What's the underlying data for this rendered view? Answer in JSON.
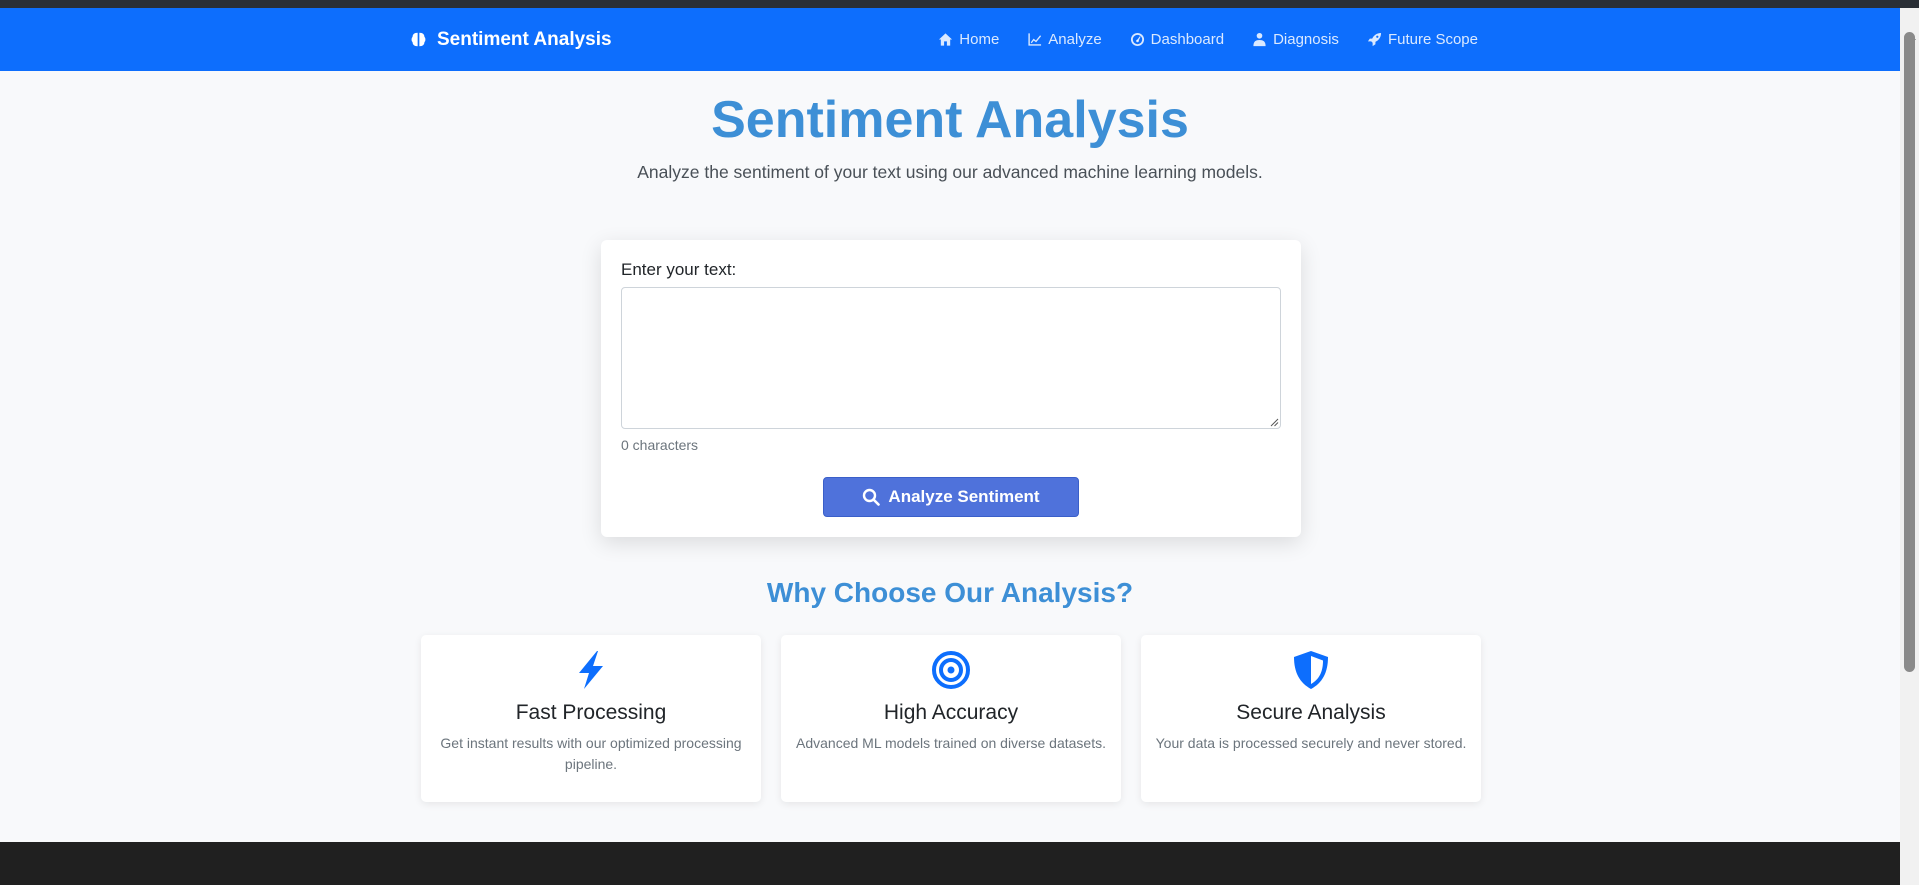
{
  "navbar": {
    "brand": "Sentiment Analysis",
    "brand_icon": "brain-icon",
    "links": [
      {
        "label": "Home",
        "icon": "home-icon"
      },
      {
        "label": "Analyze",
        "icon": "chart-line-icon"
      },
      {
        "label": "Dashboard",
        "icon": "gauge-icon"
      },
      {
        "label": "Diagnosis",
        "icon": "user-md-icon"
      },
      {
        "label": "Future Scope",
        "icon": "rocket-icon"
      }
    ]
  },
  "hero": {
    "title": "Sentiment Analysis",
    "subtitle": "Analyze the sentiment of your text using our advanced machine learning models."
  },
  "analyzer": {
    "label": "Enter your text:",
    "text_value": "",
    "placeholder": "",
    "char_count": "0",
    "char_suffix": " characters",
    "button_label": "Analyze Sentiment",
    "button_icon": "search-icon"
  },
  "why": {
    "title": "Why Choose Our Analysis?",
    "features": [
      {
        "title": "Fast Processing",
        "description": "Get instant results with our optimized processing pipeline.",
        "icon": "bolt-icon"
      },
      {
        "title": "High Accuracy",
        "description": "Advanced ML models trained on diverse datasets.",
        "icon": "target-icon"
      },
      {
        "title": "Secure Analysis",
        "description": "Your data is processed securely and never stored.",
        "icon": "shield-icon"
      }
    ]
  },
  "colors": {
    "navbar": "#0d6efd",
    "accent_title": "#3d8fd6",
    "button": "#4f72db",
    "icon_blue": "#0d6efd",
    "footer": "#202020"
  }
}
